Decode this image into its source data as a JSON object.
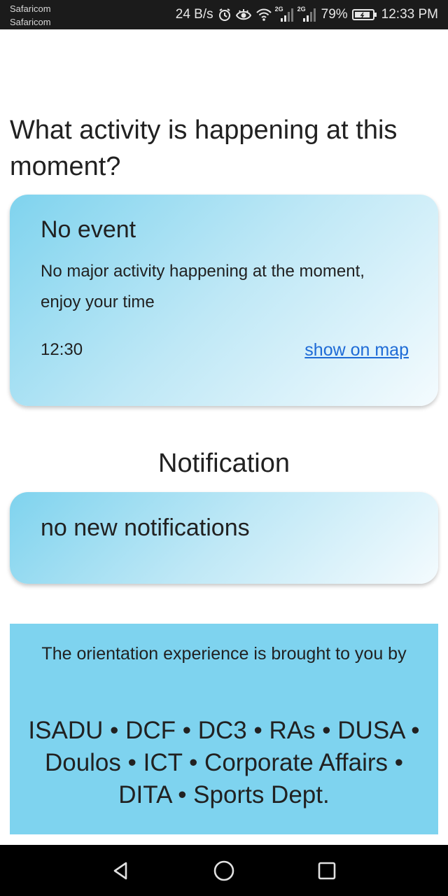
{
  "status_bar": {
    "carrier_1": "Safaricom",
    "carrier_2": "Safaricom",
    "net_speed": "24 B/s",
    "signal_1_tag": "2G",
    "signal_2_tag": "2G",
    "battery_percent": "79%",
    "time": "12:33 PM",
    "icons": [
      "alarm-icon",
      "eye-comfort-icon",
      "wifi-icon",
      "signal-icon",
      "signal-icon",
      "battery-icon"
    ]
  },
  "main": {
    "question": "What activity is happening at this moment?",
    "event_card": {
      "title": "No event",
      "description": "No major activity happening at the moment, enjoy your time",
      "time": "12:30",
      "map_link": "show on map"
    },
    "notification_heading": "Notification",
    "notification_card": {
      "text": "no new notifications"
    },
    "sponsors": {
      "intro": "The orientation experience is brought to you by",
      "list": "ISADU • DCF • DC3 • RAs • DUSA • Doulos • ICT • Corporate Affairs • DITA • Sports Dept."
    }
  },
  "nav_bar": {
    "icons": [
      "back-icon",
      "home-icon",
      "recents-icon"
    ]
  },
  "colors": {
    "status_bar_bg": "#1b1b1b",
    "card_gradient_start": "#7fd3ee",
    "card_gradient_end": "#f4fbfe",
    "sponsor_bg": "#7ed3ef",
    "link": "#1e6bd6",
    "nav_bar_bg": "#000000"
  }
}
